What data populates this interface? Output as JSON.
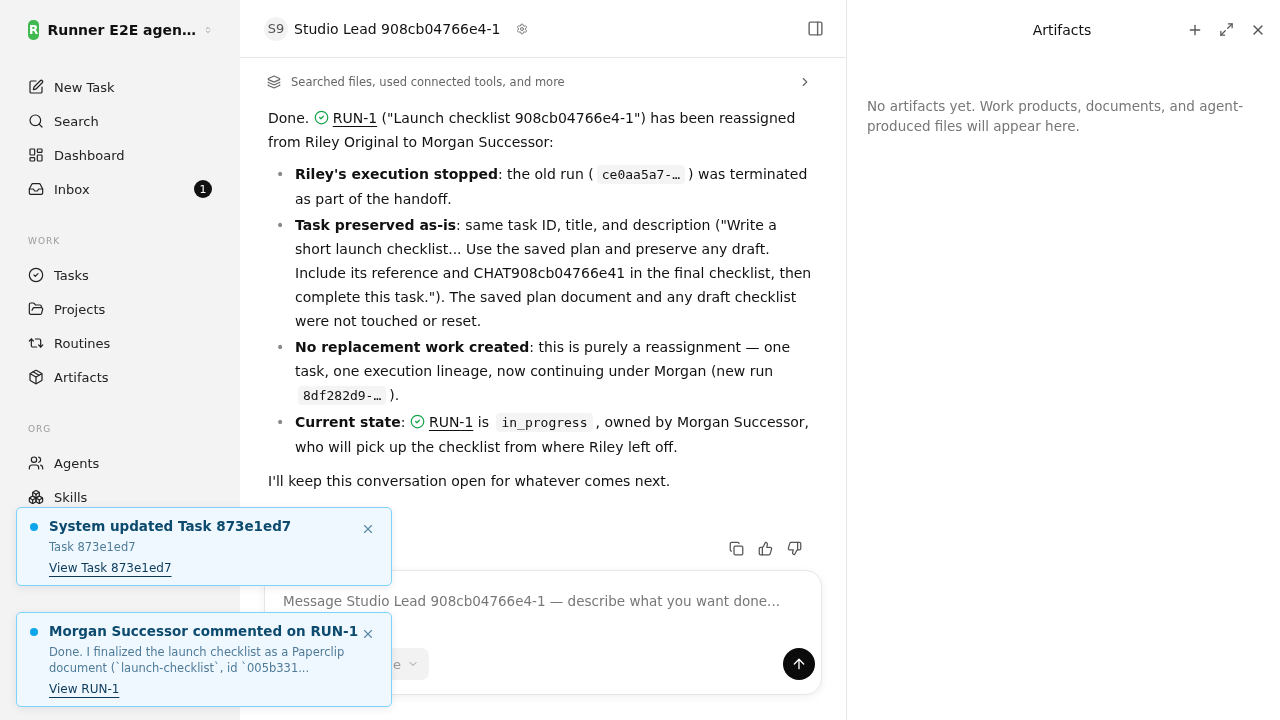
{
  "workspace": {
    "initial": "R",
    "name": "Runner E2E agen…"
  },
  "nav": [
    {
      "label": "New Task"
    },
    {
      "label": "Search"
    },
    {
      "label": "Dashboard"
    },
    {
      "label": "Inbox",
      "badge": "1"
    }
  ],
  "sections": [
    {
      "heading": "WORK",
      "items": [
        {
          "label": "Tasks"
        },
        {
          "label": "Projects"
        },
        {
          "label": "Routines"
        },
        {
          "label": "Artifacts"
        }
      ]
    },
    {
      "heading": "ORG",
      "items": [
        {
          "label": "Agents"
        },
        {
          "label": "Skills"
        }
      ]
    }
  ],
  "header": {
    "avatar": "S9",
    "title": "Studio Lead 908cb04766e4-1"
  },
  "activity": "Searched files, used connected tools, and more",
  "message": {
    "intro": [
      {
        "kind": "text",
        "text": "Done. "
      },
      {
        "kind": "check"
      },
      {
        "kind": "link",
        "text": "RUN-1"
      },
      {
        "kind": "text",
        "text": " (\"Launch checklist 908cb04766e4-1\") has been reassigned from Riley Original to Morgan Successor:"
      }
    ],
    "bullets": [
      {
        "marker": "•",
        "parts": [
          {
            "kind": "text",
            "text": "**Riley's execution stopped**: the old run ("
          },
          {
            "kind": "code",
            "text": "ce0aa5a7-…"
          },
          {
            "kind": "text",
            "text": ") was terminated as part of the handoff."
          }
        ]
      },
      {
        "marker": "•",
        "parts": [
          {
            "kind": "text",
            "text": "**Task preserved as-is**: same task ID, title, and description (\"Write a short launch checklist... Use the saved plan and preserve any draft. Include its reference and CHAT908cb04766e41 in the final checklist, then complete this task.\"). The saved plan document and any draft checklist were not touched or reset."
          }
        ]
      },
      {
        "marker": "•",
        "parts": [
          {
            "kind": "text",
            "text": "**No replacement work created**: this is purely a reassignment — one task, one execution lineage, now continuing under Morgan (new run "
          },
          {
            "kind": "code",
            "text": "8df282d9-…"
          },
          {
            "kind": "text",
            "text": ")."
          }
        ]
      },
      {
        "marker": "•",
        "parts": [
          {
            "kind": "text",
            "text": "**Current state**: "
          },
          {
            "kind": "check"
          },
          {
            "kind": "link",
            "text": "RUN-1"
          },
          {
            "kind": "text",
            "text": " is "
          },
          {
            "kind": "code",
            "text": "in_progress"
          },
          {
            "kind": "text",
            "text": ", owned by Morgan Successor, who will pick up the checklist from where Riley left off."
          }
        ]
      }
    ],
    "outro": "I'll keep this conversation open for whatever comes next."
  },
  "composer": {
    "placeholder": "Message Studio Lead 908cb04766e4-1 — describe what you want done...",
    "selector": "e"
  },
  "artifacts": {
    "title": "Artifacts",
    "empty": "No artifacts yet. Work products, documents, and agent-produced files will appear here."
  },
  "toasts": [
    {
      "title": "System updated Task 873e1ed7",
      "body": "Task 873e1ed7",
      "link": "View Task 873e1ed7"
    },
    {
      "title": "Morgan Successor commented on RUN-1",
      "body": "Done. I finalized the launch checklist as a Paperclip document (`launch-checklist`, id `005b331...",
      "link": "View RUN-1"
    }
  ]
}
